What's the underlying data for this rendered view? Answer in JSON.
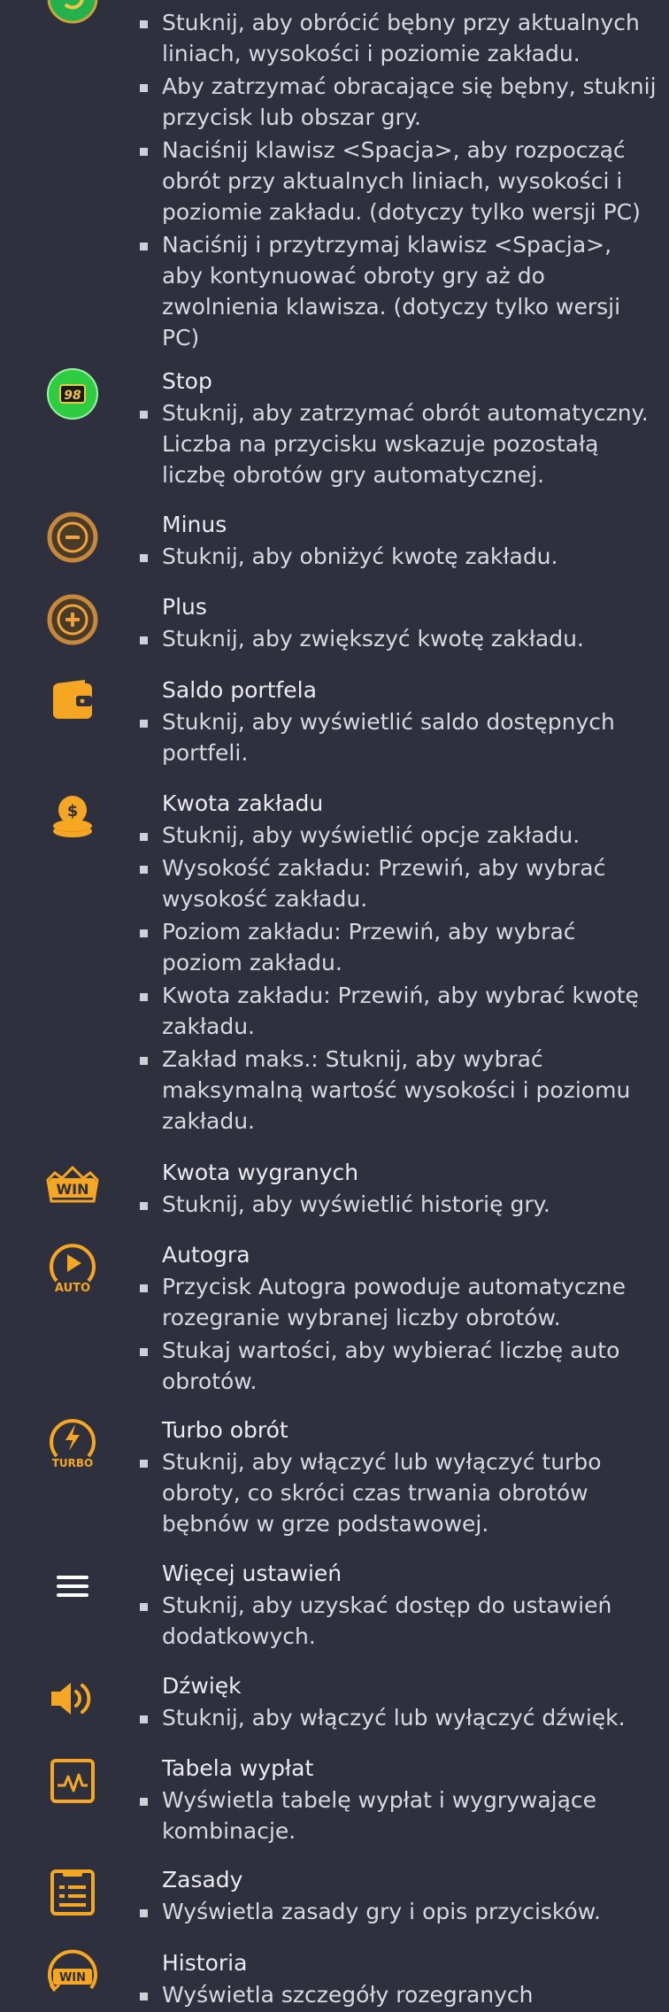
{
  "colors": {
    "background": "#2f303d",
    "accent": "#f5a623",
    "green": "#2ecc40"
  },
  "rows": [
    {
      "icon": "spin-icon",
      "title": "",
      "bullets": [
        "Stuknij, aby obrócić bębny przy aktualnych liniach, wysokości i poziomie zakładu.",
        "Aby zatrzymać obracające się bębny, stuknij przycisk lub obszar gry.",
        "Naciśnij klawisz <Spacja>, aby rozpocząć obrót przy aktualnych liniach, wysokości i poziomie zakładu. (dotyczy tylko wersji PC)",
        "Naciśnij i przytrzymaj klawisz <Spacja>, aby kontynuować obroty gry aż do zwolnienia klawisza. (dotyczy tylko wersji PC)"
      ]
    },
    {
      "icon": "stop-autoplay-icon",
      "icon_text": "98",
      "title": "Stop",
      "bullets": [
        "Stuknij, aby zatrzymać obrót automatyczny. Liczba na przycisku wskazuje pozostałą liczbę obrotów gry automatycznej."
      ]
    },
    {
      "icon": "minus-icon",
      "title": "Minus",
      "bullets": [
        "Stuknij, aby obniżyć kwotę zakładu."
      ]
    },
    {
      "icon": "plus-icon",
      "title": "Plus",
      "bullets": [
        "Stuknij, aby zwiększyć kwotę zakładu."
      ]
    },
    {
      "icon": "wallet-icon",
      "title": "Saldo portfela",
      "bullets": [
        "Stuknij, aby wyświetlić saldo dostępnych portfeli."
      ]
    },
    {
      "icon": "coins-icon",
      "title": "Kwota zakładu",
      "bullets": [
        "Stuknij, aby wyświetlić opcje zakładu.",
        "Wysokość zakładu: Przewiń, aby wybrać wysokość zakładu.",
        "Poziom zakładu: Przewiń, aby wybrać poziom zakładu.",
        "Kwota zakładu: Przewiń, aby wybrać kwotę zakładu.",
        "Zakład maks.: Stuknij, aby wybrać maksymalną wartość wysokości i poziomu zakładu."
      ]
    },
    {
      "icon": "win-icon",
      "icon_text": "WIN",
      "title": "Kwota wygranych",
      "bullets": [
        "Stuknij, aby wyświetlić historię gry."
      ]
    },
    {
      "icon": "autoplay-icon",
      "icon_text": "AUTO",
      "title": "Autogra",
      "bullets": [
        "Przycisk Autogra powoduje automatyczne rozegranie wybranej liczby obrotów.",
        "Stukaj wartości, aby wybierać liczbę auto obrotów."
      ]
    },
    {
      "icon": "turbo-icon",
      "icon_text": "TURBO",
      "title": "Turbo obrót",
      "bullets": [
        "Stuknij, aby włączyć lub wyłączyć turbo obroty, co skróci czas trwania obrotów bębnów w grze podstawowej."
      ]
    },
    {
      "icon": "menu-icon",
      "title": "Więcej ustawień",
      "bullets": [
        "Stuknij, aby uzyskać dostęp do ustawień dodatkowych."
      ]
    },
    {
      "icon": "sound-icon",
      "title": "Dźwięk",
      "bullets": [
        "Stuknij, aby włączyć lub wyłączyć dźwięk."
      ]
    },
    {
      "icon": "paytable-icon",
      "title": "Tabela wypłat",
      "bullets": [
        "Wyświetla tabelę wypłat i wygrywające kombinacje."
      ]
    },
    {
      "icon": "rules-icon",
      "title": "Zasady",
      "bullets": [
        "Wyświetla zasady gry i opis przycisków."
      ]
    },
    {
      "icon": "history-icon",
      "icon_text": "WIN",
      "title": "Historia",
      "bullets": [
        "Wyświetla szczegóły rozegranych"
      ]
    }
  ]
}
